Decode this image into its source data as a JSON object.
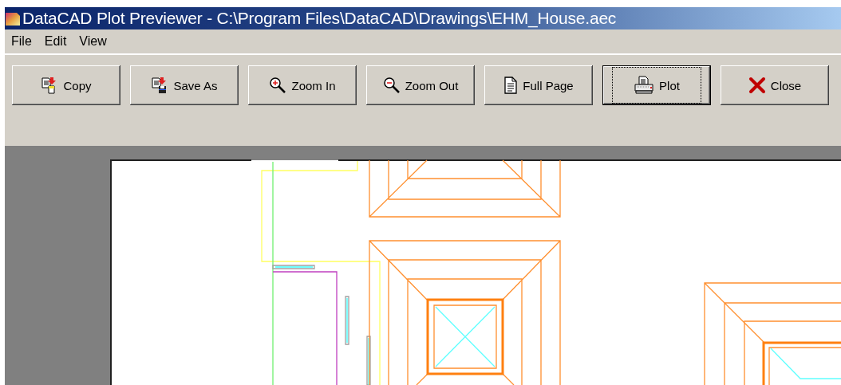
{
  "window": {
    "title": "DataCAD Plot Previewer - C:\\Program Files\\DataCAD\\Drawings\\EHM_House.aec"
  },
  "menu": [
    {
      "label": "File"
    },
    {
      "label": "Edit"
    },
    {
      "label": "View"
    }
  ],
  "toolbar": [
    {
      "label": "Copy",
      "kind": "copy",
      "focused": false
    },
    {
      "label": "Save As",
      "kind": "save",
      "focused": false
    },
    {
      "label": "Zoom In",
      "kind": "zoom-in",
      "focused": false
    },
    {
      "label": "Zoom Out",
      "kind": "zoom-out",
      "focused": false
    },
    {
      "label": "Full Page",
      "kind": "page",
      "focused": false
    },
    {
      "label": "Plot",
      "kind": "plot",
      "focused": true
    },
    {
      "label": "Close",
      "kind": "close",
      "focused": false
    }
  ]
}
